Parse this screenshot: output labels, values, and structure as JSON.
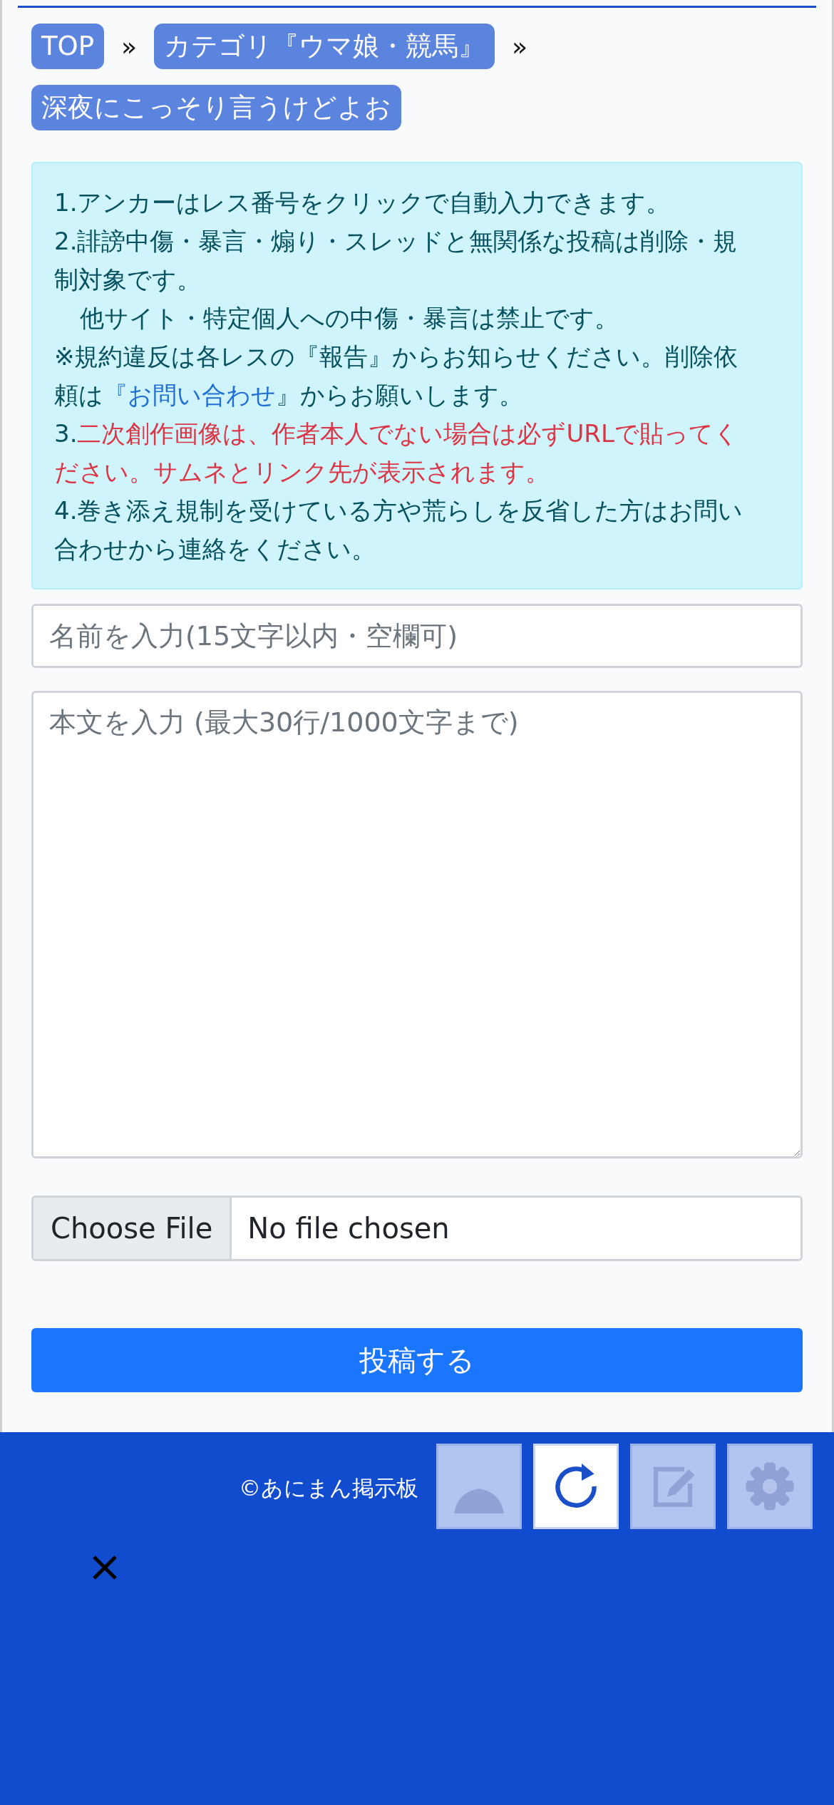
{
  "breadcrumbs": [
    {
      "label": "TOP",
      "separator": "»"
    },
    {
      "label": "カテゴリ『ウマ娘・競馬』",
      "separator": "»"
    },
    {
      "label": "深夜にこっそり言うけどよお"
    }
  ],
  "notice": [
    {
      "indented": false,
      "parts": [
        {
          "kind": "text",
          "text": "1.アンカーはレス番号をクリックで自動入力できます。"
        }
      ]
    },
    {
      "indented": false,
      "parts": [
        {
          "kind": "text",
          "text": "2.誹謗中傷・暴言・煽り・スレッドと無関係な投稿は削除・規制対象です。"
        }
      ]
    },
    {
      "indented": true,
      "parts": [
        {
          "kind": "text",
          "text": "他サイト・特定個人への中傷・暴言は禁止です。"
        }
      ]
    },
    {
      "indented": false,
      "parts": [
        {
          "kind": "text",
          "text": "※規約違反は各レスの『報告』からお知らせください。削除依頼は"
        },
        {
          "kind": "link",
          "text": "『お問い合わせ"
        },
        {
          "kind": "text",
          "text": "』からお願いします。"
        }
      ]
    },
    {
      "indented": false,
      "parts": [
        {
          "kind": "text",
          "text": "3."
        },
        {
          "kind": "warning",
          "text": "二次創作画像は、作者本人でない場合は必ずURLで貼ってください。サムネとリンク先が表示されます。"
        }
      ]
    },
    {
      "indented": false,
      "parts": [
        {
          "kind": "text",
          "text": "4.巻き添え規制を受けている方や荒らしを反省した方はお問い合わせから連絡をください。"
        }
      ]
    }
  ],
  "form": {
    "name_placeholder": "名前を入力(15文字以内・空欄可)",
    "body_placeholder": "本文を入力 (最大30行/1000文字まで)",
    "file_button": "Choose File",
    "file_status": "No file chosen",
    "submit": "投稿する"
  },
  "footer": {
    "copyright": "©あにまん掲示板"
  },
  "float_buttons": [
    {
      "kind": "up",
      "disabled": true
    },
    {
      "kind": "reload",
      "disabled": false
    },
    {
      "kind": "edit",
      "disabled": true
    },
    {
      "kind": "settings",
      "disabled": true
    }
  ]
}
